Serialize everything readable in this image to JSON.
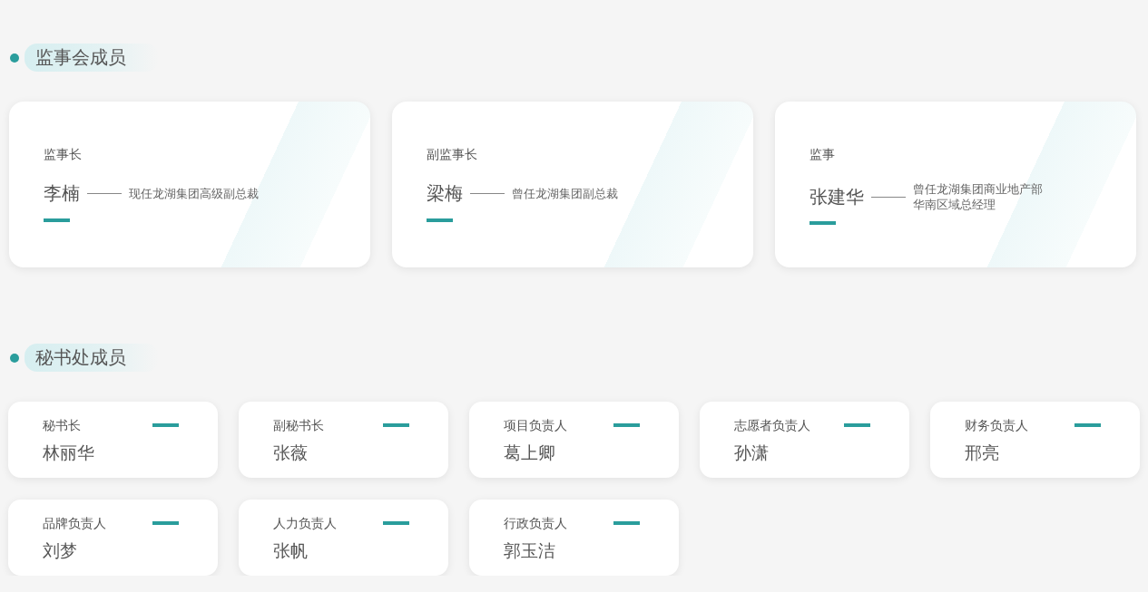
{
  "supervisory_board": {
    "title": "监事会成员",
    "members": [
      {
        "role": "监事长",
        "name": "李楠",
        "bio_lines": [
          "现任龙湖集团高级副总裁"
        ]
      },
      {
        "role": "副监事长",
        "name": "梁梅",
        "bio_lines": [
          "曾任龙湖集团副总裁"
        ]
      },
      {
        "role": "监事",
        "name": "张建华",
        "bio_lines": [
          "曾任龙湖集团商业地产部",
          "华南区域总经理"
        ]
      }
    ]
  },
  "secretariat": {
    "title": "秘书处成员",
    "members": [
      {
        "role": "秘书长",
        "name": "林丽华"
      },
      {
        "role": "副秘书长",
        "name": "张薇"
      },
      {
        "role": "项目负责人",
        "name": "葛上卿"
      },
      {
        "role": "志愿者负责人",
        "name": "孙潇"
      },
      {
        "role": "财务负责人",
        "name": "邢亮"
      },
      {
        "role": "品牌负责人",
        "name": "刘梦"
      },
      {
        "role": "人力负责人",
        "name": "张帆"
      },
      {
        "role": "行政负责人",
        "name": "郭玉洁"
      }
    ]
  }
}
